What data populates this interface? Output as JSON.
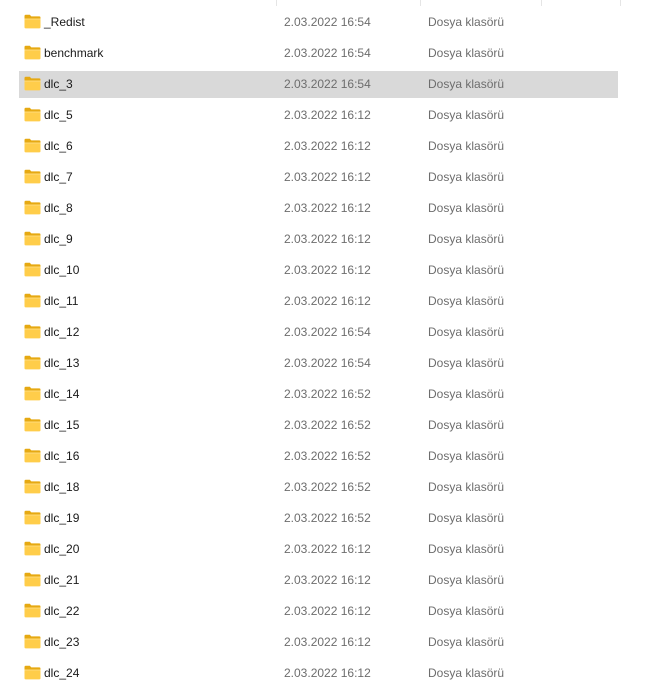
{
  "colors": {
    "selection_bg": "#d9d9d9",
    "folder_body": "#ffcd4a",
    "folder_back": "#e6a912",
    "secondary_text": "#6d6d6d"
  },
  "icon": "folder-icon",
  "files": [
    {
      "name": "_Redist",
      "date": "2.03.2022 16:54",
      "type": "Dosya klasörü",
      "selected": false
    },
    {
      "name": "benchmark",
      "date": "2.03.2022 16:54",
      "type": "Dosya klasörü",
      "selected": false
    },
    {
      "name": "dlc_3",
      "date": "2.03.2022 16:54",
      "type": "Dosya klasörü",
      "selected": true
    },
    {
      "name": "dlc_5",
      "date": "2.03.2022 16:12",
      "type": "Dosya klasörü",
      "selected": false
    },
    {
      "name": "dlc_6",
      "date": "2.03.2022 16:12",
      "type": "Dosya klasörü",
      "selected": false
    },
    {
      "name": "dlc_7",
      "date": "2.03.2022 16:12",
      "type": "Dosya klasörü",
      "selected": false
    },
    {
      "name": "dlc_8",
      "date": "2.03.2022 16:12",
      "type": "Dosya klasörü",
      "selected": false
    },
    {
      "name": "dlc_9",
      "date": "2.03.2022 16:12",
      "type": "Dosya klasörü",
      "selected": false
    },
    {
      "name": "dlc_10",
      "date": "2.03.2022 16:12",
      "type": "Dosya klasörü",
      "selected": false
    },
    {
      "name": "dlc_11",
      "date": "2.03.2022 16:12",
      "type": "Dosya klasörü",
      "selected": false
    },
    {
      "name": "dlc_12",
      "date": "2.03.2022 16:54",
      "type": "Dosya klasörü",
      "selected": false
    },
    {
      "name": "dlc_13",
      "date": "2.03.2022 16:54",
      "type": "Dosya klasörü",
      "selected": false
    },
    {
      "name": "dlc_14",
      "date": "2.03.2022 16:52",
      "type": "Dosya klasörü",
      "selected": false
    },
    {
      "name": "dlc_15",
      "date": "2.03.2022 16:52",
      "type": "Dosya klasörü",
      "selected": false
    },
    {
      "name": "dlc_16",
      "date": "2.03.2022 16:52",
      "type": "Dosya klasörü",
      "selected": false
    },
    {
      "name": "dlc_18",
      "date": "2.03.2022 16:52",
      "type": "Dosya klasörü",
      "selected": false
    },
    {
      "name": "dlc_19",
      "date": "2.03.2022 16:52",
      "type": "Dosya klasörü",
      "selected": false
    },
    {
      "name": "dlc_20",
      "date": "2.03.2022 16:12",
      "type": "Dosya klasörü",
      "selected": false
    },
    {
      "name": "dlc_21",
      "date": "2.03.2022 16:12",
      "type": "Dosya klasörü",
      "selected": false
    },
    {
      "name": "dlc_22",
      "date": "2.03.2022 16:12",
      "type": "Dosya klasörü",
      "selected": false
    },
    {
      "name": "dlc_23",
      "date": "2.03.2022 16:12",
      "type": "Dosya klasörü",
      "selected": false
    },
    {
      "name": "dlc_24",
      "date": "2.03.2022 16:12",
      "type": "Dosya klasörü",
      "selected": false
    }
  ]
}
